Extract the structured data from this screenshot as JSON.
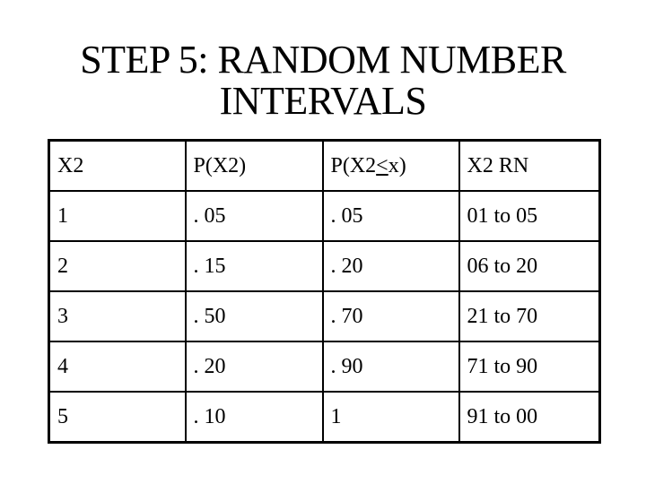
{
  "slide": {
    "title_line1": "STEP 5: RANDOM NUMBER",
    "title_line2": "INTERVALS"
  },
  "table": {
    "headers": {
      "x": "X2",
      "p": "P(X2)",
      "cum_prefix": "P(X2",
      "cum_symbol": "<",
      "cum_suffix": "x)",
      "rn": "X2 RN"
    },
    "rows": [
      {
        "x": "1",
        "p": ". 05",
        "cum": ". 05",
        "rn": "01 to 05"
      },
      {
        "x": "2",
        "p": ". 15",
        "cum": ". 20",
        "rn": "06 to 20"
      },
      {
        "x": "3",
        "p": ". 50",
        "cum": ". 70",
        "rn": "21 to 70"
      },
      {
        "x": "4",
        "p": ". 20",
        "cum": ". 90",
        "rn": "71 to 90"
      },
      {
        "x": "5",
        "p": ". 10",
        "cum": "1",
        "rn": "91 to 00"
      }
    ]
  }
}
